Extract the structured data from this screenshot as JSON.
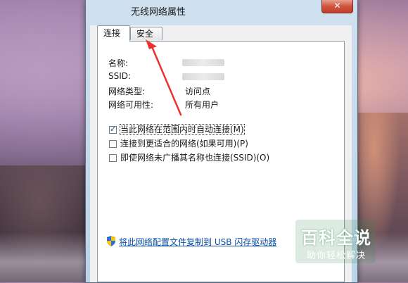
{
  "window": {
    "title": "无线网络属性",
    "close_glyph": "✕"
  },
  "tabs": [
    {
      "label": "连接",
      "active": true
    },
    {
      "label": "安全",
      "active": false
    }
  ],
  "properties": [
    {
      "label": "名称:",
      "value": ""
    },
    {
      "label": "SSID:",
      "value": ""
    },
    {
      "label": "网络类型:",
      "value": "访问点"
    },
    {
      "label": "网络可用性:",
      "value": "所有用户"
    }
  ],
  "options": [
    {
      "label": "当此网络在范围内时自动连接(M)",
      "checked": true
    },
    {
      "label": "连接到更适合的网络(如果可用)(P)",
      "checked": false
    },
    {
      "label": "即使网络未广播其名称也连接(SSID)(O)",
      "checked": false
    }
  ],
  "link": {
    "label": "将此网络配置文件复制到 USB 闪存驱动器",
    "icon": "uac-shield-icon"
  },
  "watermark": {
    "main": "百科全说",
    "sub": "助你轻松解决"
  },
  "colors": {
    "annotation_arrow": "#e8322a",
    "link": "#0b4ea2"
  }
}
